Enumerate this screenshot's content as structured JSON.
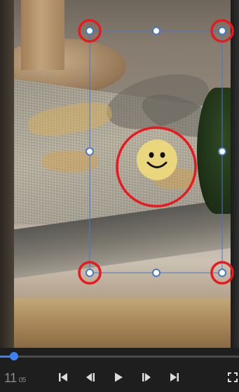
{
  "player": {
    "current_time": "11",
    "current_frames": "05",
    "progress_fraction": 0.06
  },
  "controls": {
    "icons": [
      "skip-to-start-icon",
      "step-back-icon",
      "play-icon",
      "step-forward-icon",
      "skip-to-end-icon",
      "fullscreen-icon"
    ]
  },
  "overlay": {
    "sticker": "smiley-face-sticker",
    "highlight_color": "#e8191f",
    "handle_color": "#4a78c2"
  }
}
